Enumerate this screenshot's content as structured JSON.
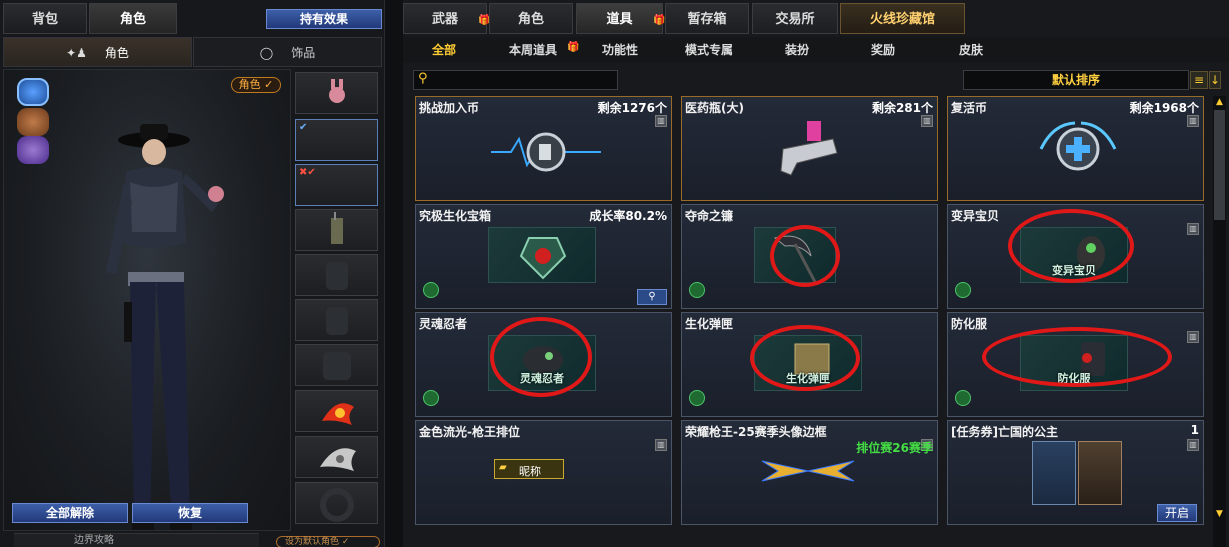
{
  "left": {
    "tabs": [
      {
        "label": "背包",
        "active": false
      },
      {
        "label": "角色",
        "active": true
      }
    ],
    "holding_effect_button": "持有效果",
    "subtabs": [
      {
        "label": "角色",
        "active": true
      },
      {
        "label": "饰品",
        "active": false
      }
    ],
    "character_badge": "角色 ✓",
    "actions": {
      "unequip_all": "全部解除",
      "restore": "恢复"
    },
    "bottom_text": "边界攻略",
    "bottom_text2": "设为默认角色 ✓"
  },
  "right": {
    "main_tabs": [
      {
        "label": "武器",
        "active": false,
        "new": true
      },
      {
        "label": "角色",
        "active": false,
        "new": false
      },
      {
        "label": "道具",
        "active": true,
        "new": true
      },
      {
        "label": "暂存箱",
        "active": false,
        "new": false
      },
      {
        "label": "交易所",
        "active": false,
        "new": false
      },
      {
        "label": "火线珍藏馆",
        "active": false,
        "new": false
      }
    ],
    "category_tabs": [
      {
        "label": "全部",
        "active": true,
        "new": false
      },
      {
        "label": "本周道具",
        "active": false,
        "new": true
      },
      {
        "label": "功能性",
        "active": false,
        "new": false
      },
      {
        "label": "模式专属",
        "active": false,
        "new": false
      },
      {
        "label": "装扮",
        "active": false,
        "new": false
      },
      {
        "label": "奖励",
        "active": false,
        "new": false
      },
      {
        "label": "皮肤",
        "active": false,
        "new": false
      }
    ],
    "search": {
      "value": ""
    },
    "sort_label": "默认排序",
    "items": [
      {
        "name": "挑战加入币",
        "info": "剩余1276个"
      },
      {
        "name": "医药瓶(大)",
        "info": "剩余281个"
      },
      {
        "name": "复活币",
        "info": "剩余1968个"
      },
      {
        "name": "究极生化宝箱",
        "info": "成长率80.2%"
      },
      {
        "name": "夺命之镰",
        "info": ""
      },
      {
        "name": "变异宝贝",
        "info": "",
        "art_label": "变异宝贝"
      },
      {
        "name": "灵魂忍者",
        "info": "",
        "art_label": "灵魂忍者"
      },
      {
        "name": "生化弹匣",
        "info": "",
        "art_label": "生化弹匣"
      },
      {
        "name": "防化服",
        "info": "",
        "art_label": "防化服"
      },
      {
        "name": "金色流光-枪王排位",
        "info": "",
        "art_label": "昵称"
      },
      {
        "name": "荣耀枪王-25赛季头像边框",
        "info": "",
        "extra": "排位赛26赛季"
      },
      {
        "name": "[任务券]亡国的公主",
        "info": "1",
        "button": "开启"
      }
    ]
  }
}
